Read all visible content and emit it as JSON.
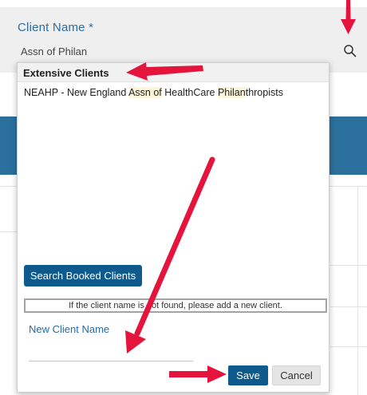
{
  "client_field": {
    "label": "Client Name *",
    "value": "Assn of Philan"
  },
  "dropdown": {
    "header": "Extensive Clients",
    "result": {
      "parts": [
        {
          "text": "NEAHP - New England ",
          "highlight": false
        },
        {
          "text": "Assn of",
          "highlight": true
        },
        {
          "text": " HealthCare ",
          "highlight": false
        },
        {
          "text": "Philan",
          "highlight": true
        },
        {
          "text": "thropists",
          "highlight": false
        }
      ]
    },
    "search_booked_label": "Search Booked Clients",
    "notice": "If the client name is not found, please add a new client.",
    "new_client_label": "New Client Name",
    "new_client_value": "",
    "save_label": "Save",
    "cancel_label": "Cancel"
  },
  "colors": {
    "primary": "#0f5a8c",
    "label_blue": "#2d6ca0",
    "band_blue": "#2b6f9c",
    "annotation_red": "#e4143c",
    "highlight": "#fbf6d9"
  }
}
